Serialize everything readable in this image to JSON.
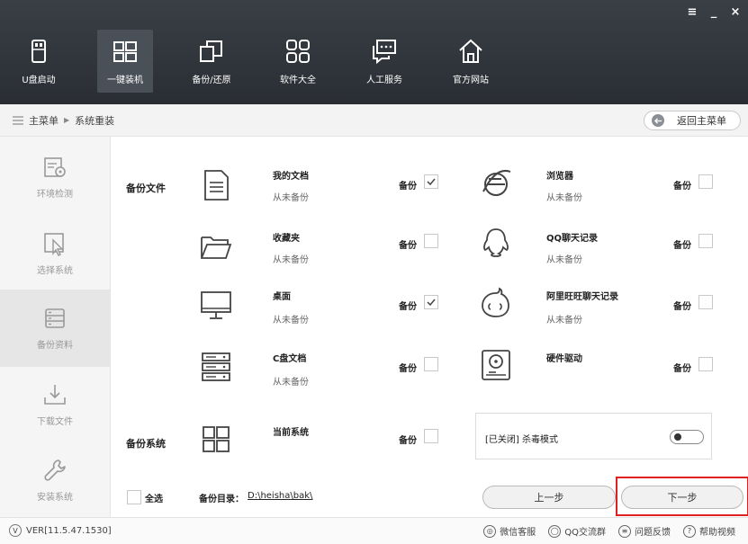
{
  "window_controls": {
    "menu": "≡",
    "minimize": "_",
    "close": "×"
  },
  "nav": [
    {
      "label": "U盘启动",
      "icon": "usb-icon"
    },
    {
      "label": "一键装机",
      "icon": "windows-icon",
      "active": true
    },
    {
      "label": "备份/还原",
      "icon": "copy-icon"
    },
    {
      "label": "软件大全",
      "icon": "apps-icon"
    },
    {
      "label": "人工服务",
      "icon": "chat-icon"
    },
    {
      "label": "官方网站",
      "icon": "home-icon"
    }
  ],
  "breadcrumb": {
    "root": "主菜单",
    "current": "系统重装"
  },
  "back_button": "返回主菜单",
  "sidebar": [
    {
      "label": "环境检测",
      "icon": "check-environment-icon"
    },
    {
      "label": "选择系统",
      "icon": "cursor-icon"
    },
    {
      "label": "备份资料",
      "icon": "backup-icon",
      "active": true
    },
    {
      "label": "下载文件",
      "icon": "download-icon"
    },
    {
      "label": "安装系统",
      "icon": "wrench-icon"
    }
  ],
  "sections": {
    "files": "备份文件",
    "system": "备份系统"
  },
  "backup_word": "备份",
  "items": [
    {
      "name": "我的文档",
      "status": "从未备份",
      "checked": true,
      "icon": "document-icon"
    },
    {
      "name": "浏览器",
      "status": "从未备份",
      "checked": false,
      "icon": "browser-icon"
    },
    {
      "name": "收藏夹",
      "status": "从未备份",
      "checked": false,
      "icon": "folder-icon"
    },
    {
      "name": "QQ聊天记录",
      "status": "从未备份",
      "checked": false,
      "icon": "qq-icon"
    },
    {
      "name": "桌面",
      "status": "从未备份",
      "checked": true,
      "icon": "monitor-icon"
    },
    {
      "name": "阿里旺旺聊天记录",
      "status": "从未备份",
      "checked": false,
      "icon": "wangwang-icon"
    },
    {
      "name": "C盘文档",
      "status": "从未备份",
      "checked": false,
      "icon": "server-icon"
    },
    {
      "name": "硬件驱动",
      "status": "",
      "checked": false,
      "icon": "harddisk-icon"
    }
  ],
  "system_item": {
    "name": "当前系统",
    "checked": false,
    "icon": "windows-logo-icon"
  },
  "antivirus": {
    "label": "[已关闭] 杀毒模式",
    "enabled": false
  },
  "bottom": {
    "select_all": "全选",
    "dir_label": "备份目录：",
    "dir_path": "D:\\heisha\\bak\\",
    "prev": "上一步",
    "next": "下一步"
  },
  "footer": {
    "version": "VER[11.5.47.1530]",
    "links": [
      "微信客服",
      "QQ交流群",
      "问题反馈",
      "帮助视频"
    ]
  }
}
